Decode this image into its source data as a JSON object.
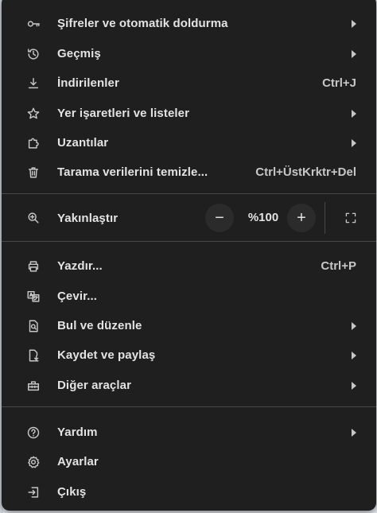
{
  "menu": {
    "items_top": [
      {
        "label": "Şifreler ve otomatik doldurma",
        "icon": "key-icon",
        "has_submenu": true,
        "shortcut": ""
      },
      {
        "label": "Geçmiş",
        "icon": "history-icon",
        "has_submenu": true,
        "shortcut": ""
      },
      {
        "label": "İndirilenler",
        "icon": "download-icon",
        "has_submenu": false,
        "shortcut": "Ctrl+J"
      },
      {
        "label": "Yer işaretleri ve listeler",
        "icon": "star-icon",
        "has_submenu": true,
        "shortcut": ""
      },
      {
        "label": "Uzantılar",
        "icon": "extension-icon",
        "has_submenu": true,
        "shortcut": ""
      },
      {
        "label": "Tarama verilerini temizle...",
        "icon": "trash-icon",
        "has_submenu": false,
        "shortcut": "Ctrl+ÜstKrktr+Del"
      }
    ],
    "zoom": {
      "label": "Yakınlaştır",
      "icon": "zoom-icon",
      "minus": "−",
      "value": "%100",
      "plus": "+",
      "fullscreen_icon": "fullscreen-icon"
    },
    "items_middle": [
      {
        "label": "Yazdır...",
        "icon": "print-icon",
        "has_submenu": false,
        "shortcut": "Ctrl+P"
      },
      {
        "label": "Çevir...",
        "icon": "translate-icon",
        "has_submenu": false,
        "shortcut": ""
      },
      {
        "label": "Bul ve düzenle",
        "icon": "find-icon",
        "has_submenu": true,
        "shortcut": ""
      },
      {
        "label": "Kaydet ve paylaş",
        "icon": "save-share-icon",
        "has_submenu": true,
        "shortcut": ""
      },
      {
        "label": "Diğer araçlar",
        "icon": "toolbox-icon",
        "has_submenu": true,
        "shortcut": ""
      }
    ],
    "items_bottom": [
      {
        "label": "Yardım",
        "icon": "help-icon",
        "has_submenu": true,
        "shortcut": ""
      },
      {
        "label": "Ayarlar",
        "icon": "settings-icon",
        "has_submenu": false,
        "shortcut": ""
      },
      {
        "label": "Çıkış",
        "icon": "exit-icon",
        "has_submenu": false,
        "shortcut": ""
      }
    ]
  },
  "colors": {
    "menu_bg": "#1f1f1f",
    "text": "#e3e3e3",
    "secondary_text": "#c7c7c7",
    "separator": "#474747"
  }
}
